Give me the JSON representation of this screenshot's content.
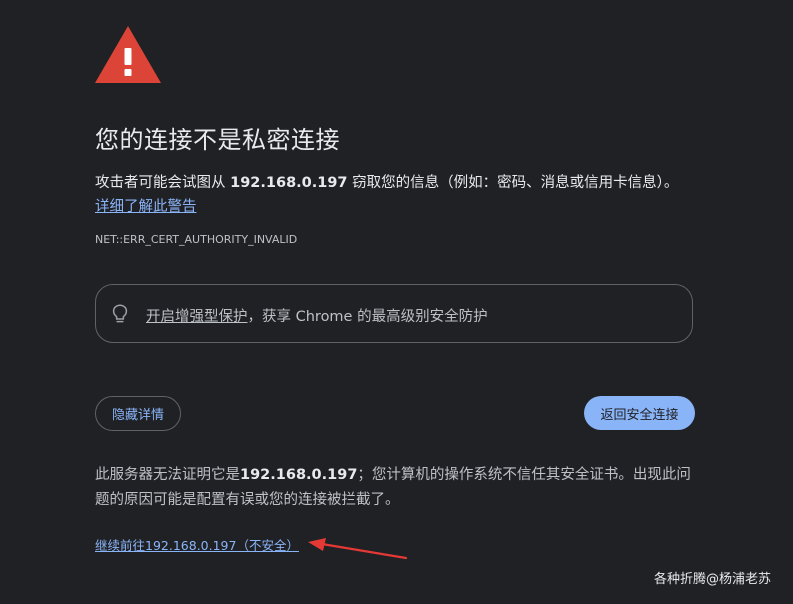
{
  "icons": {
    "warning": "warning-triangle-icon",
    "bulb": "lightbulb-icon",
    "arrow": "red-annotation-arrow"
  },
  "colors": {
    "background": "#202124",
    "warning_red": "#db4437",
    "link_blue": "#8ab4f8",
    "annotation_red": "#e53935"
  },
  "title": "您的连接不是私密连接",
  "description": {
    "prefix": "攻击者可能会试图从 ",
    "host": "192.168.0.197",
    "suffix": " 窃取您的信息（例如：密码、消息或信用卡信息）。"
  },
  "learn_more": "详细了解此警告",
  "error_code": "NET::ERR_CERT_AUTHORITY_INVALID",
  "enhanced_protection": {
    "link": "开启增强型保护",
    "text": "，获享 Chrome 的最高级别安全防护"
  },
  "buttons": {
    "hide_details": "隐藏详情",
    "back_to_safety": "返回安全连接"
  },
  "details": {
    "prefix": "此服务器无法证明它是",
    "host": "192.168.0.197",
    "suffix": "；您计算机的操作系统不信任其安全证书。出现此问题的原因可能是配置有误或您的连接被拦截了。"
  },
  "proceed_link": "继续前往192.168.0.197（不安全）",
  "watermark": "各种折腾@杨浦老苏"
}
